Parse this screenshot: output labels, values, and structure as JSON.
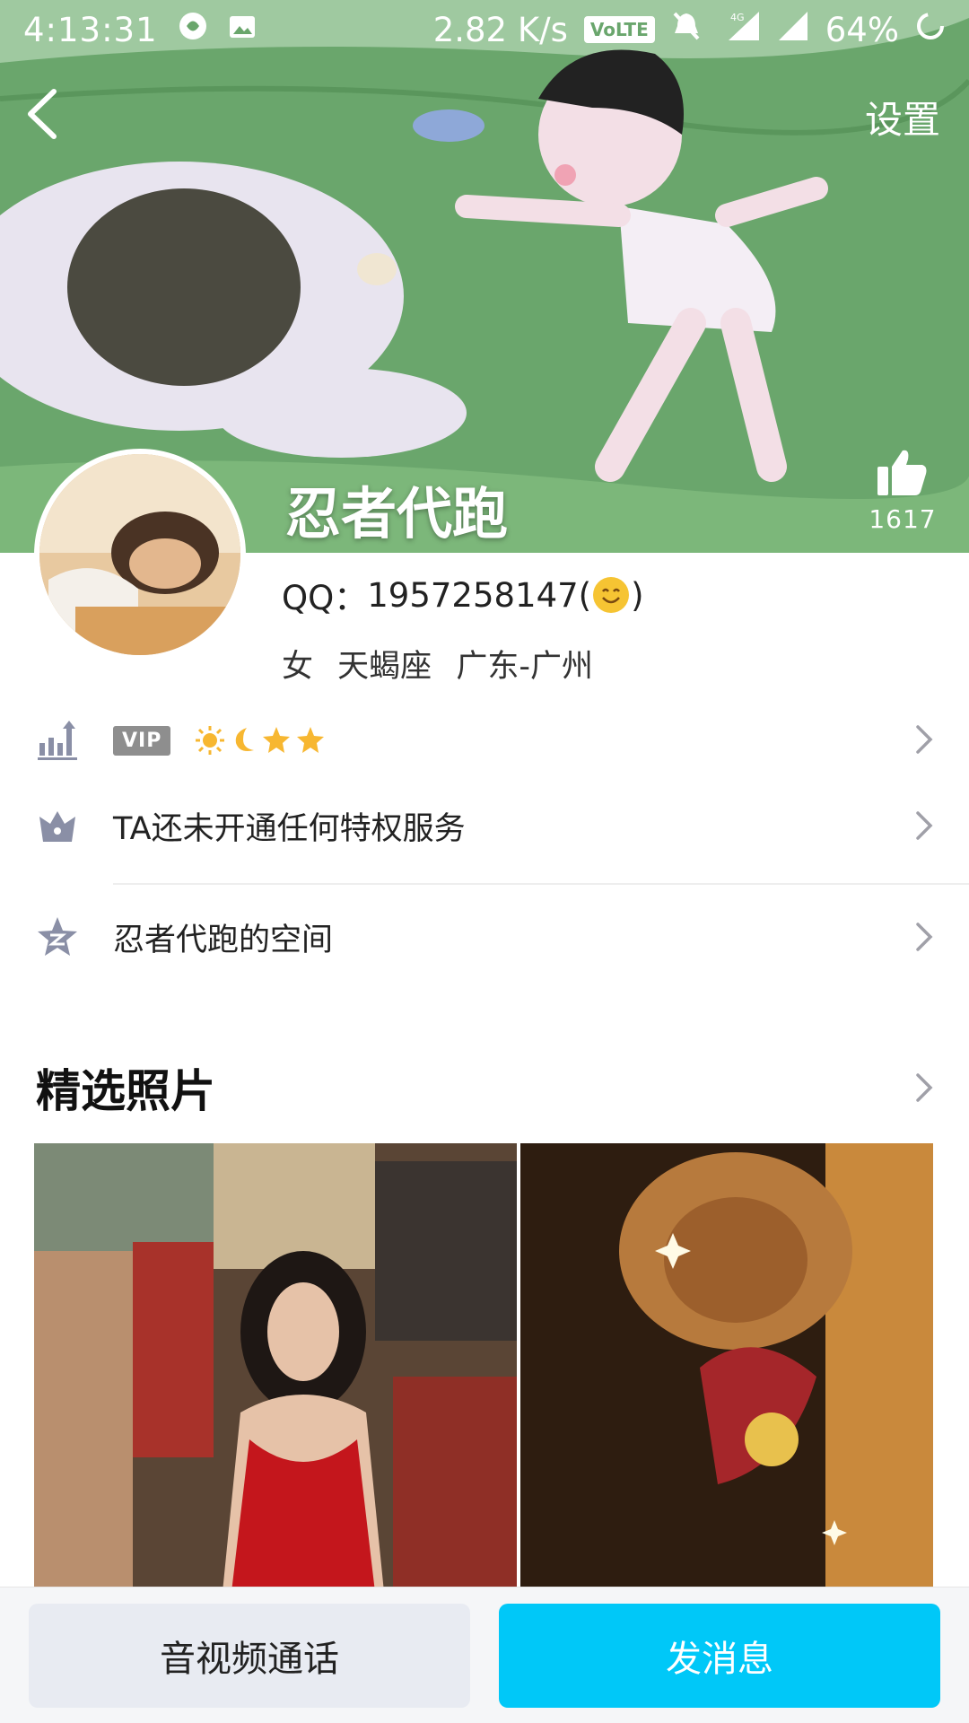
{
  "status_bar": {
    "time": "4:13:31",
    "net_speed": "2.82 K/s",
    "volte": "VoLTE",
    "network": "4G",
    "battery": "64%"
  },
  "header": {
    "settings_label": "设置",
    "nickname": "忍者代跑",
    "like_count": "1617"
  },
  "profile": {
    "qq_label": "QQ：",
    "qq_number": "1957258147",
    "paren_open": "(",
    "paren_close": ")",
    "gender": "女",
    "zodiac": "天蝎座",
    "location": "广东-广州"
  },
  "rows": {
    "level": {
      "vip_label": "VIP",
      "icons": [
        "sun-icon",
        "moon-icon",
        "star-icon",
        "star-icon"
      ]
    },
    "privilege": {
      "label": "TA还未开通任何特权服务"
    },
    "space": {
      "label": "忍者代跑的空间"
    }
  },
  "photos": {
    "title": "精选照片"
  },
  "actions": {
    "call_label": "音视频通话",
    "message_label": "发消息"
  },
  "colors": {
    "accent": "#00c8f8",
    "icon_gray": "#8a8fa6"
  }
}
